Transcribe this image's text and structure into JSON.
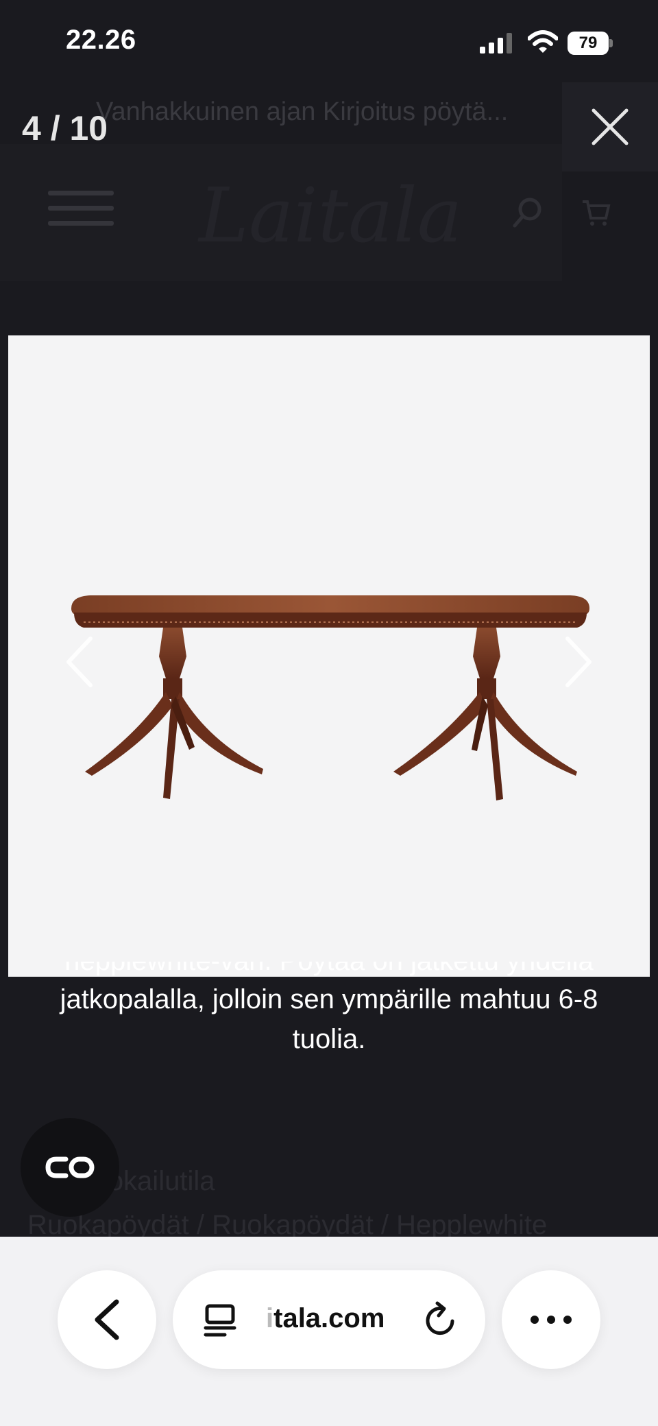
{
  "status_bar": {
    "time": "22.26",
    "battery": "79"
  },
  "background_page": {
    "title_fragment": "Vanhakkuinen ajan Kirjoitus pöytä...",
    "logo": "Laitala",
    "breadcrumbs_line1": "... / Ruokailutila",
    "breadcrumbs_line2": "Ruokapöydät / Ruokapöydät / Hepplewhite"
  },
  "gallery": {
    "counter": "4 / 10",
    "close_label": "×"
  },
  "caption": {
    "line1": "hepplewhite-väri. Pöytää on jatkettu yhdellä",
    "line2": "jatkopalalla, jolloin sen ympärille mahtuu 6-8",
    "line3": "tuolia."
  },
  "browser": {
    "url_faded": "i",
    "url": "tala.com"
  },
  "icons": {
    "close": "close-icon",
    "prev": "chevron-left-icon",
    "next": "chevron-right-icon",
    "link": "link-icon",
    "back": "back-icon",
    "reader": "reader-icon",
    "reload": "reload-icon",
    "more": "more-icon"
  }
}
